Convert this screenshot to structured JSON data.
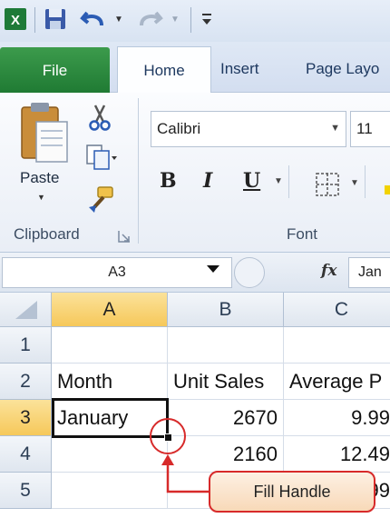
{
  "ribbon": {
    "tabs": {
      "file": "File",
      "home": "Home",
      "insert": "Insert",
      "page_layout": "Page Layo"
    },
    "clipboard": {
      "paste_label": "Paste",
      "group_label": "Clipboard"
    },
    "font": {
      "name": "Calibri",
      "size": "11",
      "bold": "B",
      "italic": "I",
      "underline": "U",
      "group_label": "Font"
    }
  },
  "formula_bar": {
    "name_box": "A3",
    "fx": "fx",
    "content": "Jan"
  },
  "sheet": {
    "columns": [
      "A",
      "B",
      "C"
    ],
    "rows": [
      "1",
      "2",
      "3",
      "4",
      "5"
    ],
    "cells": {
      "A2": "Month",
      "B2": "Unit Sales",
      "C2": "Average P",
      "A3": "January",
      "B3": "2670",
      "C3": "9.99",
      "B4": "2160",
      "C4": "12.49",
      "C5": "99"
    }
  },
  "annotation": {
    "callout": "Fill Handle",
    "color": "#d72a2a"
  },
  "colors": {
    "file_tab": "#2a8a3e",
    "selected_header": "#f6c85a"
  }
}
